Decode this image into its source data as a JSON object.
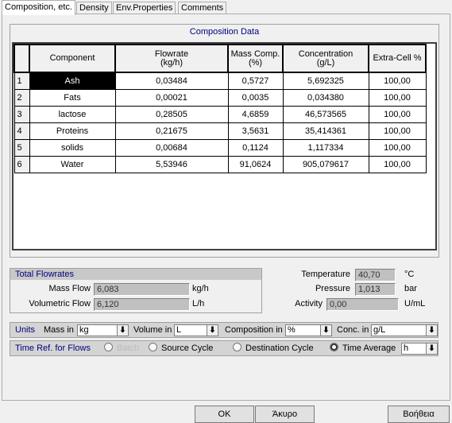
{
  "tabs": [
    {
      "label": "Composition, etc.",
      "active": true
    },
    {
      "label": "Density"
    },
    {
      "label": "Env.Properties"
    },
    {
      "label": "Comments"
    }
  ],
  "composition": {
    "title": "Composition Data",
    "headers": {
      "component": "Component",
      "flowrate": "Flowrate",
      "flowrate_unit": "(kg/h)",
      "mass": "Mass Comp.",
      "mass_unit": "(%)",
      "conc": "Concentration",
      "conc_unit": "(g/L)",
      "extra": "Extra-Cell %"
    },
    "rows": [
      {
        "n": "1",
        "component": "Ash",
        "flowrate": "0,03484",
        "mass": "0,5727",
        "conc": "5,692325",
        "extra": "100,00"
      },
      {
        "n": "2",
        "component": "Fats",
        "flowrate": "0,00021",
        "mass": "0,0035",
        "conc": "0,034380",
        "extra": "100,00"
      },
      {
        "n": "3",
        "component": "lactose",
        "flowrate": "0,28505",
        "mass": "4,6859",
        "conc": "46,573565",
        "extra": "100,00"
      },
      {
        "n": "4",
        "component": "Proteins",
        "flowrate": "0,21675",
        "mass": "3,5631",
        "conc": "35,414361",
        "extra": "100,00"
      },
      {
        "n": "5",
        "component": "solids",
        "flowrate": "0,00684",
        "mass": "0,1124",
        "conc": "1,117334",
        "extra": "100,00"
      },
      {
        "n": "6",
        "component": "Water",
        "flowrate": "5,53946",
        "mass": "91,0624",
        "conc": "905,079617",
        "extra": "100,00"
      }
    ]
  },
  "totals": {
    "title": "Total Flowrates",
    "mass_label": "Mass Flow",
    "mass_value": "6,083",
    "mass_unit": "kg/h",
    "vol_label": "Volumetric Flow",
    "vol_value": "6,120",
    "vol_unit": "L/h"
  },
  "props": {
    "temp_label": "Temperature",
    "temp_value": "40,70",
    "temp_unit": "°C",
    "pres_label": "Pressure",
    "pres_value": "1,013",
    "pres_unit": "bar",
    "act_label": "Activity",
    "act_value": "0,00",
    "act_unit": "U/mL"
  },
  "units": {
    "title": "Units",
    "mass_label": "Mass in",
    "mass": "kg",
    "vol_label": "Volume in",
    "vol": "L",
    "comp_label": "Composition in",
    "comp": "%",
    "conc_label": "Conc. in",
    "conc": "g/L"
  },
  "timeref": {
    "title": "Time Ref. for Flows",
    "batch": "Batch",
    "source": "Source Cycle",
    "dest": "Destination Cycle",
    "avg": "Time Average",
    "selected": "Time Average",
    "unit": "h"
  },
  "buttons": {
    "ok": "OK",
    "cancel": "Άκυρο",
    "help": "Βοήθεια"
  }
}
